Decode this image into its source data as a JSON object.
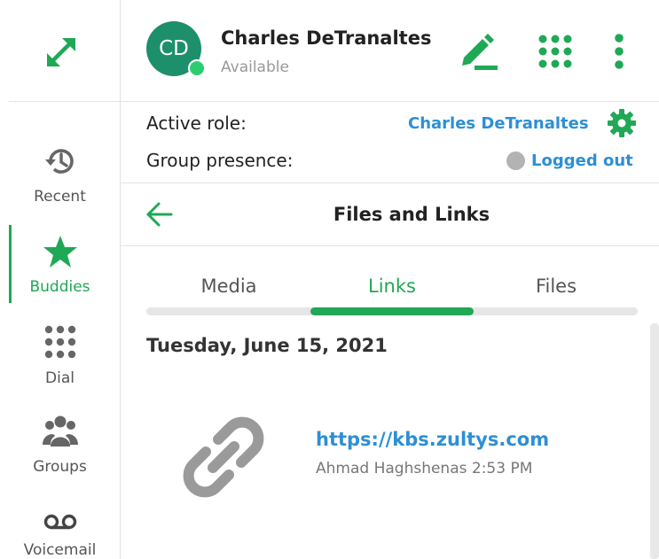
{
  "colors": {
    "accent": "#1fa855",
    "link": "#2d8fd5",
    "avatar_bg": "#1e8f6b",
    "available": "#2ecc71",
    "logged_out": "#b3b3b3"
  },
  "sidebar": {
    "expand_icon": "expand-arrows-icon",
    "items": [
      {
        "label": "Recent",
        "icon": "history-icon",
        "active": false
      },
      {
        "label": "Buddies",
        "icon": "star-icon",
        "active": true
      },
      {
        "label": "Dial",
        "icon": "dialpad-icon",
        "active": false
      },
      {
        "label": "Groups",
        "icon": "groups-icon",
        "active": false
      },
      {
        "label": "Voicemail",
        "icon": "voicemail-icon",
        "active": false
      }
    ]
  },
  "header": {
    "avatar_initials": "CD",
    "user_name": "Charles DeTranaltes",
    "status": "Available",
    "icons": [
      "edit-icon",
      "apps-grid-icon",
      "more-vertical-icon"
    ]
  },
  "roles": {
    "active_role_label": "Active role:",
    "active_role_value": "Charles DeTranaltes",
    "group_presence_label": "Group presence:",
    "group_presence_value": "Logged out"
  },
  "panel": {
    "title": "Files and Links",
    "tabs": [
      {
        "label": "Media",
        "active": false
      },
      {
        "label": "Links",
        "active": true
      },
      {
        "label": "Files",
        "active": false
      }
    ],
    "date": "Tuesday, June 15, 2021",
    "link": {
      "url": "https://kbs.zultys.com",
      "meta": "Ahmad Haghshenas 2:53 PM"
    }
  }
}
